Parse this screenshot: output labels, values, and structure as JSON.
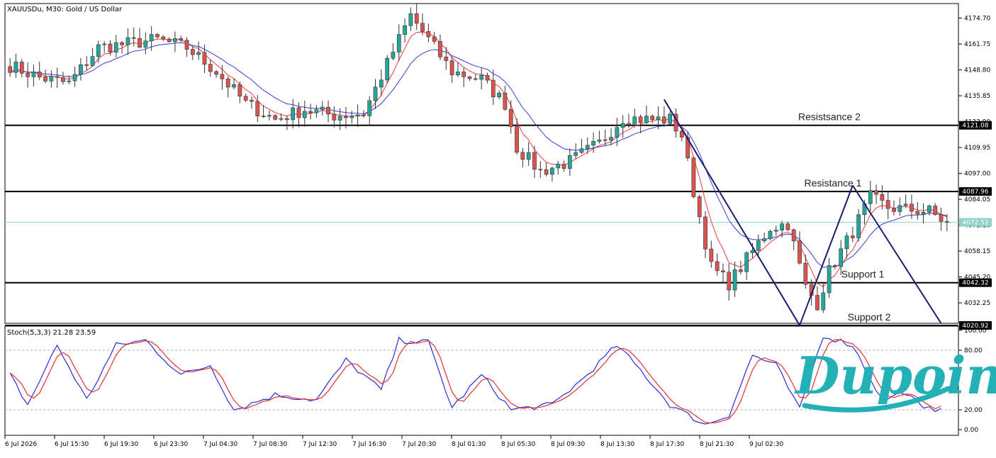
{
  "header": {
    "symbol": "XAUUSDu, M30:  Gold / US Dollar",
    "indicator": "Stoch(5,3,3) 21.28 23.59"
  },
  "colors": {
    "bull": "#26a69a",
    "bear": "#d9534f",
    "ma_fast": "#f03c3c",
    "ma_slow": "#3a3ad8",
    "stoch_k": "#2b2bdc",
    "stoch_d": "#e83030",
    "current_line": "#8dd3c7",
    "trend": "#1c1c70",
    "logo": "#23b0b6"
  },
  "logo": {
    "text": "Dupoin"
  },
  "chart_data": {
    "type": "candlestick",
    "symbol": "XAUUSDu",
    "timeframe": "M30",
    "ylim": [
      4022,
      4182
    ],
    "y_ticks": [
      4174.7,
      4161.75,
      4148.8,
      4135.85,
      4122.9,
      4109.95,
      4097.0,
      4084.05,
      4071.1,
      4058.15,
      4045.2,
      4032.25
    ],
    "x_ticks": [
      "6 Jul 2026",
      "6 Jul 15:30",
      "6 Jul 19:30",
      "6 Jul 23:30",
      "7 Jul 04:30",
      "7 Jul 08:30",
      "7 Jul 12:30",
      "7 Jul 16:30",
      "7 Jul 20:30",
      "8 Jul 01:30",
      "8 Jul 05:30",
      "8 Jul 09:30",
      "8 Jul 13:30",
      "8 Jul 17:30",
      "8 Jul 21:30",
      "9 Jul 02:30"
    ],
    "anchors": [
      [
        0,
        4151
      ],
      [
        5,
        4145
      ],
      [
        10,
        4142
      ],
      [
        15,
        4160
      ],
      [
        20,
        4162
      ],
      [
        25,
        4164
      ],
      [
        30,
        4160
      ],
      [
        35,
        4148
      ],
      [
        40,
        4132
      ],
      [
        45,
        4124
      ],
      [
        50,
        4129
      ],
      [
        55,
        4126
      ],
      [
        60,
        4127
      ],
      [
        65,
        4158
      ],
      [
        68,
        4176
      ],
      [
        72,
        4160
      ],
      [
        75,
        4148
      ],
      [
        80,
        4144
      ],
      [
        84,
        4132
      ],
      [
        86,
        4110
      ],
      [
        90,
        4098
      ],
      [
        95,
        4103
      ],
      [
        100,
        4112
      ],
      [
        104,
        4125
      ],
      [
        108,
        4124
      ],
      [
        112,
        4124
      ],
      [
        114,
        4116
      ],
      [
        116,
        4088
      ],
      [
        119,
        4050
      ],
      [
        122,
        4042
      ],
      [
        126,
        4058
      ],
      [
        129,
        4070
      ],
      [
        132,
        4072
      ],
      [
        135,
        4040
      ],
      [
        137,
        4032
      ],
      [
        139,
        4048
      ],
      [
        143,
        4068
      ],
      [
        146,
        4085
      ],
      [
        149,
        4080
      ],
      [
        152,
        4079
      ],
      [
        156,
        4078
      ],
      [
        159,
        4072
      ]
    ],
    "candle_count": 160,
    "ma_fast_period": 5,
    "ma_slow_period": 12,
    "current_price": "4072.52",
    "levels": [
      {
        "name": "Resistsance 2",
        "value": 4121.08,
        "tag": "4121.08"
      },
      {
        "name": "Resistance 1",
        "value": 4087.96,
        "tag": "4087.96"
      },
      {
        "name": "Support 1",
        "value": 4042.32,
        "tag": "4042.32"
      },
      {
        "name": "Support 2",
        "value": 4020.92,
        "tag": "4020.92"
      }
    ],
    "trend_lines": [
      [
        [
          111,
          4134
        ],
        [
          134,
          4021
        ]
      ],
      [
        [
          134,
          4021
        ],
        [
          143,
          4091
        ]
      ],
      [
        [
          143,
          4091
        ],
        [
          158,
          4022
        ]
      ]
    ],
    "stochastic": {
      "params": "5,3,3",
      "k_current": 21.28,
      "d_current": 23.59,
      "ylim": [
        0,
        100
      ],
      "y_ticks": [
        100.0,
        80.0,
        20.0,
        0.0
      ],
      "levels": [
        80,
        20
      ],
      "k_anchors": [
        [
          0,
          55
        ],
        [
          3,
          25
        ],
        [
          8,
          85
        ],
        [
          13,
          30
        ],
        [
          18,
          85
        ],
        [
          23,
          90
        ],
        [
          29,
          55
        ],
        [
          34,
          65
        ],
        [
          38,
          20
        ],
        [
          45,
          35
        ],
        [
          52,
          30
        ],
        [
          57,
          70
        ],
        [
          63,
          40
        ],
        [
          66,
          90
        ],
        [
          71,
          88
        ],
        [
          75,
          22
        ],
        [
          80,
          55
        ],
        [
          85,
          20
        ],
        [
          92,
          25
        ],
        [
          97,
          50
        ],
        [
          103,
          85
        ],
        [
          107,
          60
        ],
        [
          112,
          25
        ],
        [
          118,
          5
        ],
        [
          122,
          15
        ],
        [
          126,
          75
        ],
        [
          130,
          65
        ],
        [
          134,
          20
        ],
        [
          138,
          95
        ],
        [
          143,
          85
        ],
        [
          148,
          30
        ],
        [
          152,
          38
        ],
        [
          155,
          20
        ],
        [
          158,
          21.28
        ]
      ]
    }
  }
}
